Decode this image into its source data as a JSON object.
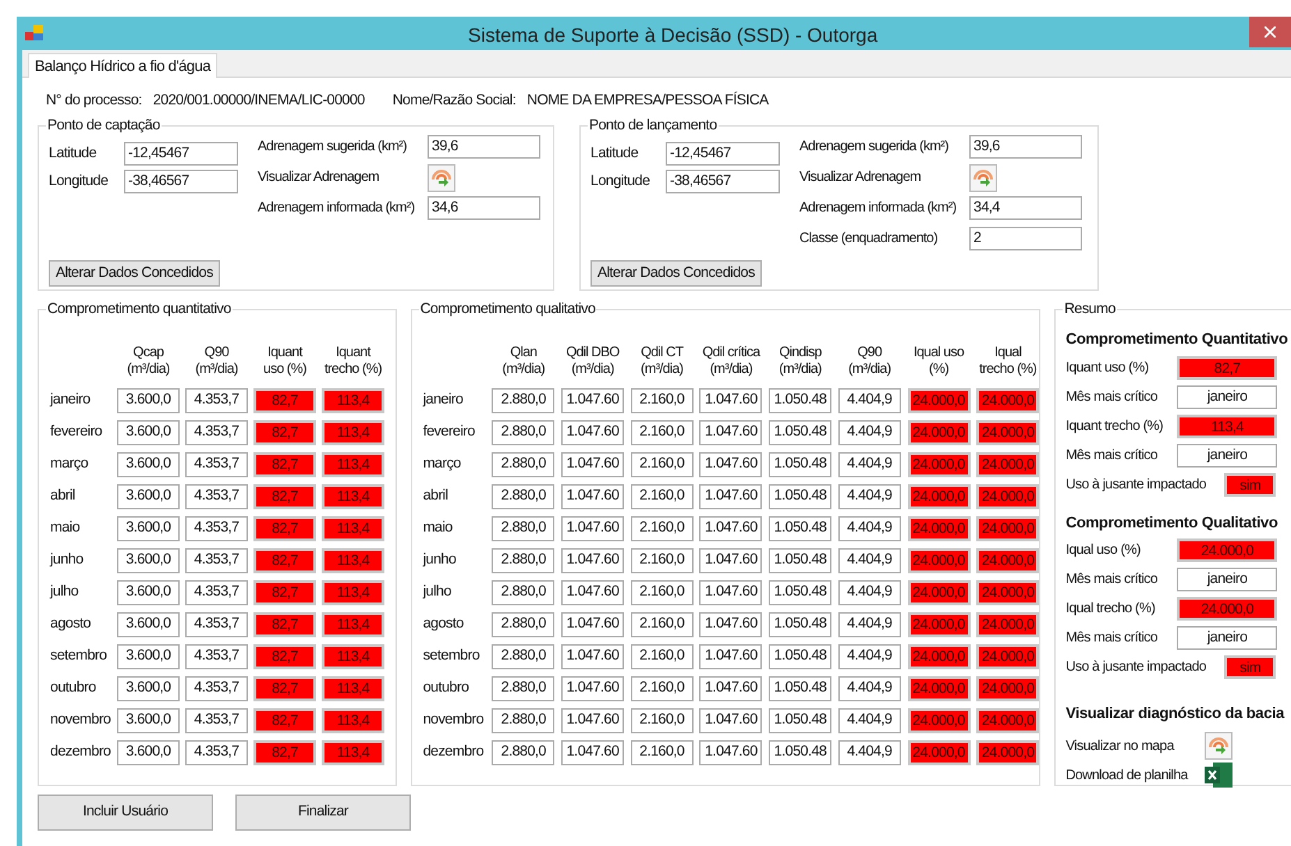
{
  "window": {
    "title": "Sistema de Suporte à Decisão (SSD) - Outorga"
  },
  "tabs": [
    {
      "label": "Balanço Hídrico a fio d'água",
      "selected": true
    }
  ],
  "process": {
    "label": "N° do processo:",
    "value": "2020/001.00000/INEMA/LIC-00000",
    "name_label": "Nome/Razão Social:",
    "name_value": "NOME DA EMPRESA/PESSOA FÍSICA"
  },
  "points": [
    {
      "title": "Ponto de captação",
      "left": [
        {
          "label": "Latitude",
          "value": "-12,45467"
        },
        {
          "label": "Longitude",
          "value": "-38,46567"
        }
      ],
      "right": [
        {
          "kind": "field",
          "label": "Adrenagem sugerida (km²)",
          "value": "39,6"
        },
        {
          "kind": "map_button",
          "label": "Visualizar Adrenagem"
        },
        {
          "kind": "field",
          "label": "Adrenagem informada (km²)",
          "value": "34,6"
        }
      ],
      "button": "Alterar Dados Concedidos"
    },
    {
      "title": "Ponto de lançamento",
      "left": [
        {
          "label": "Latitude",
          "value": "-12,45467"
        },
        {
          "label": "Longitude",
          "value": "-38,46567"
        }
      ],
      "right": [
        {
          "kind": "field",
          "label": "Adrenagem sugerida (km²)",
          "value": "39,6"
        },
        {
          "kind": "map_button",
          "label": "Visualizar Adrenagem"
        },
        {
          "kind": "field",
          "label": "Adrenagem informada (km²)",
          "value": "34,4"
        },
        {
          "kind": "field",
          "label": "Classe (enquadramento)",
          "value": "2"
        }
      ],
      "button": "Alterar Dados Concedidos"
    }
  ],
  "quantitative": {
    "title": "Comprometimento quantitativo",
    "columns": [
      {
        "label": "Qcap\n(m³/dia)",
        "alert": false
      },
      {
        "label": "Q90\n(m³/dia)",
        "alert": false
      },
      {
        "label": "Iquant\nuso (%)",
        "alert": true
      },
      {
        "label": "Iquant\ntrecho (%)",
        "alert": true
      }
    ],
    "rows": [
      {
        "month": "janeiro",
        "values": [
          "3.600,0",
          "4.353,7",
          "82,7",
          "113,4"
        ]
      },
      {
        "month": "fevereiro",
        "values": [
          "3.600,0",
          "4.353,7",
          "82,7",
          "113,4"
        ]
      },
      {
        "month": "março",
        "values": [
          "3.600,0",
          "4.353,7",
          "82,7",
          "113,4"
        ]
      },
      {
        "month": "abril",
        "values": [
          "3.600,0",
          "4.353,7",
          "82,7",
          "113,4"
        ]
      },
      {
        "month": "maio",
        "values": [
          "3.600,0",
          "4.353,7",
          "82,7",
          "113,4"
        ]
      },
      {
        "month": "junho",
        "values": [
          "3.600,0",
          "4.353,7",
          "82,7",
          "113,4"
        ]
      },
      {
        "month": "julho",
        "values": [
          "3.600,0",
          "4.353,7",
          "82,7",
          "113,4"
        ]
      },
      {
        "month": "agosto",
        "values": [
          "3.600,0",
          "4.353,7",
          "82,7",
          "113,4"
        ]
      },
      {
        "month": "setembro",
        "values": [
          "3.600,0",
          "4.353,7",
          "82,7",
          "113,4"
        ]
      },
      {
        "month": "outubro",
        "values": [
          "3.600,0",
          "4.353,7",
          "82,7",
          "113,4"
        ]
      },
      {
        "month": "novembro",
        "values": [
          "3.600,0",
          "4.353,7",
          "82,7",
          "113,4"
        ]
      },
      {
        "month": "dezembro",
        "values": [
          "3.600,0",
          "4.353,7",
          "82,7",
          "113,4"
        ]
      }
    ]
  },
  "qualitative": {
    "title": "Comprometimento qualitativo",
    "columns": [
      {
        "label": "Qlan\n(m³/dia)",
        "alert": false
      },
      {
        "label": "Qdil DBO\n(m³/dia)",
        "alert": false
      },
      {
        "label": "Qdil CT\n(m³/dia)",
        "alert": false
      },
      {
        "label": "Qdil crítica\n(m³/dia)",
        "alert": false
      },
      {
        "label": "Qindisp\n(m³/dia)",
        "alert": false
      },
      {
        "label": "Q90\n(m³/dia)",
        "alert": false
      },
      {
        "label": "Iqual uso\n(%)",
        "alert": true
      },
      {
        "label": "Iqual\ntrecho (%)",
        "alert": true
      }
    ],
    "rows": [
      {
        "month": "janeiro",
        "values": [
          "2.880,0",
          "1.047.60",
          "2.160,0",
          "1.047.60",
          "1.050.48",
          "4.404,9",
          "24.000,0",
          "24.000,0"
        ]
      },
      {
        "month": "fevereiro",
        "values": [
          "2.880,0",
          "1.047.60",
          "2.160,0",
          "1.047.60",
          "1.050.48",
          "4.404,9",
          "24.000,0",
          "24.000,0"
        ]
      },
      {
        "month": "março",
        "values": [
          "2.880,0",
          "1.047.60",
          "2.160,0",
          "1.047.60",
          "1.050.48",
          "4.404,9",
          "24.000,0",
          "24.000,0"
        ]
      },
      {
        "month": "abril",
        "values": [
          "2.880,0",
          "1.047.60",
          "2.160,0",
          "1.047.60",
          "1.050.48",
          "4.404,9",
          "24.000,0",
          "24.000,0"
        ]
      },
      {
        "month": "maio",
        "values": [
          "2.880,0",
          "1.047.60",
          "2.160,0",
          "1.047.60",
          "1.050.48",
          "4.404,9",
          "24.000,0",
          "24.000,0"
        ]
      },
      {
        "month": "junho",
        "values": [
          "2.880,0",
          "1.047.60",
          "2.160,0",
          "1.047.60",
          "1.050.48",
          "4.404,9",
          "24.000,0",
          "24.000,0"
        ]
      },
      {
        "month": "julho",
        "values": [
          "2.880,0",
          "1.047.60",
          "2.160,0",
          "1.047.60",
          "1.050.48",
          "4.404,9",
          "24.000,0",
          "24.000,0"
        ]
      },
      {
        "month": "agosto",
        "values": [
          "2.880,0",
          "1.047.60",
          "2.160,0",
          "1.047.60",
          "1.050.48",
          "4.404,9",
          "24.000,0",
          "24.000,0"
        ]
      },
      {
        "month": "setembro",
        "values": [
          "2.880,0",
          "1.047.60",
          "2.160,0",
          "1.047.60",
          "1.050.48",
          "4.404,9",
          "24.000,0",
          "24.000,0"
        ]
      },
      {
        "month": "outubro",
        "values": [
          "2.880,0",
          "1.047.60",
          "2.160,0",
          "1.047.60",
          "1.050.48",
          "4.404,9",
          "24.000,0",
          "24.000,0"
        ]
      },
      {
        "month": "novembro",
        "values": [
          "2.880,0",
          "1.047.60",
          "2.160,0",
          "1.047.60",
          "1.050.48",
          "4.404,9",
          "24.000,0",
          "24.000,0"
        ]
      },
      {
        "month": "dezembro",
        "values": [
          "2.880,0",
          "1.047.60",
          "2.160,0",
          "1.047.60",
          "1.050.48",
          "4.404,9",
          "24.000,0",
          "24.000,0"
        ]
      }
    ]
  },
  "summary": {
    "title": "Resumo",
    "sections": [
      {
        "heading": "Comprometimento Quantitativo",
        "items": [
          {
            "kind": "field",
            "label": "Iquant uso (%)",
            "value": "82,7",
            "alert": true
          },
          {
            "kind": "field",
            "label": "Mês mais crítico",
            "value": "janeiro",
            "alert": false
          },
          {
            "kind": "field",
            "label": "Iquant trecho (%)",
            "value": "113,4",
            "alert": true
          },
          {
            "kind": "field",
            "label": "Mês mais crítico",
            "value": "janeiro",
            "alert": false
          },
          {
            "kind": "flag",
            "label": "Uso à jusante impactado",
            "value": "sim",
            "alert": true
          }
        ]
      },
      {
        "heading": "Comprometimento Qualitativo",
        "items": [
          {
            "kind": "field",
            "label": "Iqual uso (%)",
            "value": "24.000,0",
            "alert": true
          },
          {
            "kind": "field",
            "label": "Mês mais crítico",
            "value": "janeiro",
            "alert": false
          },
          {
            "kind": "field",
            "label": "Iqual trecho (%)",
            "value": "24.000,0",
            "alert": true
          },
          {
            "kind": "field",
            "label": "Mês mais crítico",
            "value": "janeiro",
            "alert": false
          },
          {
            "kind": "flag",
            "label": "Uso à jusante impactado",
            "value": "sim",
            "alert": true
          }
        ]
      },
      {
        "heading": "Visualizar diagnóstico da bacia",
        "items": [
          {
            "kind": "map_button",
            "label": "Visualizar no mapa"
          },
          {
            "kind": "sheet_button",
            "label": "Download de planilha"
          }
        ]
      }
    ]
  },
  "buttons": [
    "Incluir Usuário",
    "Finalizar"
  ]
}
